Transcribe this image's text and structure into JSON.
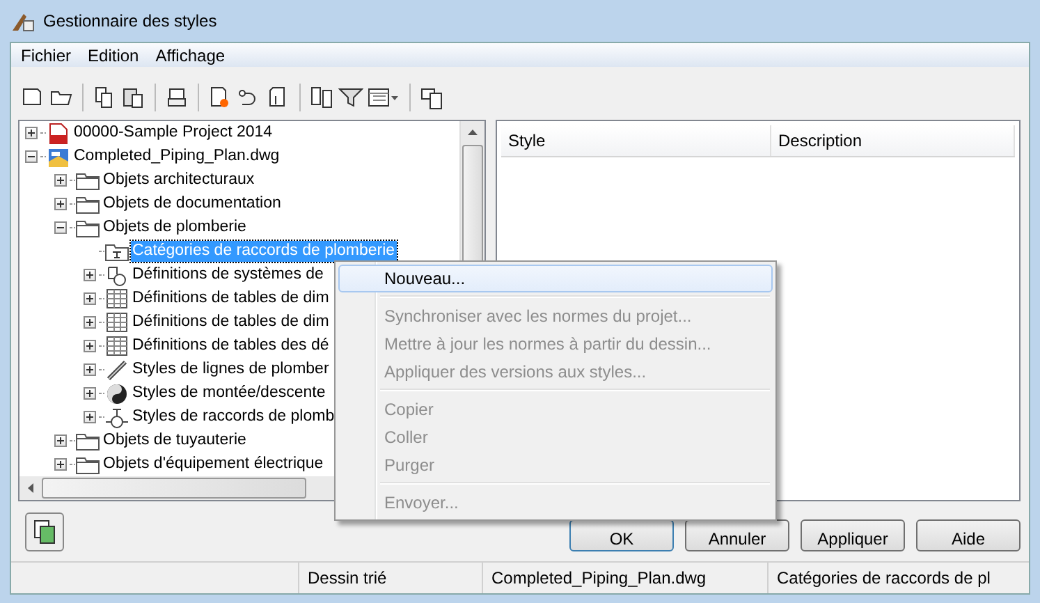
{
  "window": {
    "title": "Gestionnaire des styles"
  },
  "menu_bar": [
    "Fichier",
    "Edition",
    "Affichage"
  ],
  "tree": [
    {
      "label": "00000-Sample Project 2014",
      "kind": "pdf",
      "expanded": false,
      "selected": false
    },
    {
      "label": "Completed_Piping_Plan.dwg",
      "kind": "dwg",
      "expanded": true,
      "selected": false,
      "children": [
        {
          "label": "Objets architecturaux",
          "kind": "folder",
          "expanded": false,
          "selected": false
        },
        {
          "label": "Objets de documentation",
          "kind": "folder",
          "expanded": false,
          "selected": false
        },
        {
          "label": "Objets de plomberie",
          "kind": "folder",
          "expanded": true,
          "selected": false,
          "children": [
            {
              "label": "Catégories de raccords de plomberie",
              "kind": "category",
              "selected": true
            },
            {
              "label": "Définitions de systèmes de",
              "kind": "system",
              "expanded": false,
              "selected": false
            },
            {
              "label": "Définitions de tables de dim",
              "kind": "table",
              "expanded": false,
              "selected": false
            },
            {
              "label": "Définitions de tables de dim",
              "kind": "table",
              "expanded": false,
              "selected": false
            },
            {
              "label": "Définitions de tables des dé",
              "kind": "table",
              "expanded": false,
              "selected": false
            },
            {
              "label": "Styles de lignes de plomber",
              "kind": "line",
              "expanded": false,
              "selected": false
            },
            {
              "label": "Styles de montée/descente",
              "kind": "riser",
              "expanded": false,
              "selected": false
            },
            {
              "label": "Styles de raccords de plomb",
              "kind": "fitting",
              "expanded": false,
              "selected": false
            }
          ]
        },
        {
          "label": "Objets de tuyauterie",
          "kind": "folder",
          "expanded": false,
          "selected": false
        },
        {
          "label": "Objets d'équipement électrique",
          "kind": "folder",
          "expanded": false,
          "selected": false
        }
      ]
    }
  ],
  "list": {
    "columns": [
      "Style",
      "Description"
    ]
  },
  "buttons": [
    "OK",
    "Annuler",
    "Appliquer",
    "Aide"
  ],
  "status_bar": [
    "Dessin trié",
    "Completed_Piping_Plan.dwg",
    "Catégories de raccords de pl"
  ],
  "context_menu": [
    {
      "kind": "item",
      "label": "Nouveau...",
      "disabled": false,
      "selected": true
    },
    {
      "kind": "separator"
    },
    {
      "kind": "item",
      "label": "Synchroniser avec les normes du projet...",
      "disabled": true,
      "selected": false
    },
    {
      "kind": "item",
      "label": "Mettre à jour les normes à partir du dessin...",
      "disabled": true,
      "selected": false
    },
    {
      "kind": "item",
      "label": "Appliquer des versions aux styles...",
      "disabled": true,
      "selected": false
    },
    {
      "kind": "separator"
    },
    {
      "kind": "item",
      "label": "Copier",
      "disabled": true,
      "selected": false
    },
    {
      "kind": "item",
      "label": "Coller",
      "disabled": true,
      "selected": false
    },
    {
      "kind": "item",
      "label": "Purger",
      "disabled": true,
      "selected": false
    },
    {
      "kind": "separator"
    },
    {
      "kind": "item",
      "label": "Envoyer...",
      "disabled": true,
      "selected": false
    }
  ]
}
